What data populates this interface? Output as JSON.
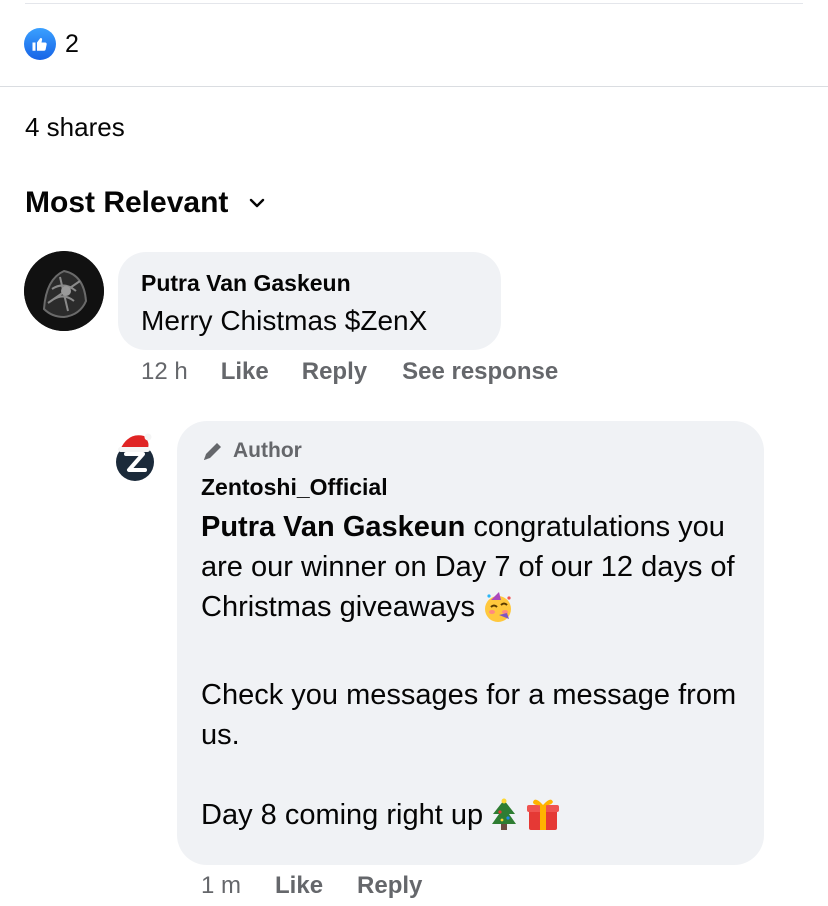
{
  "reactions": {
    "icon": "like-icon",
    "count": "2"
  },
  "shares": "4 shares",
  "sort": {
    "label": "Most Relevant",
    "icon": "chevron-down-icon"
  },
  "comments": [
    {
      "author": "Putra Van Gaskeun",
      "text": "Merry Chistmas $ZenX",
      "time": "12 h",
      "like_label": "Like",
      "reply_label": "Reply",
      "see_response_label": "See response"
    }
  ],
  "reply": {
    "badge": "Author",
    "badge_icon": "pencil-icon",
    "author": "Zentoshi_Official",
    "mention": "Putra Van Gaskeun",
    "line1_rest": " congratulations you are our winner on Day 7 of our 12 days of Christmas giveaways",
    "line2": "Check you messages for a message from us.",
    "line3": "Day 8 coming right up",
    "emojis": [
      "party-face-icon",
      "christmas-tree-icon",
      "gift-icon"
    ],
    "time": "1 m",
    "like_label": "Like",
    "reply_label": "Reply"
  },
  "colors": {
    "bubble": "#f0f2f5",
    "secondary_text": "#65676b",
    "like_blue": "#1877f2"
  }
}
